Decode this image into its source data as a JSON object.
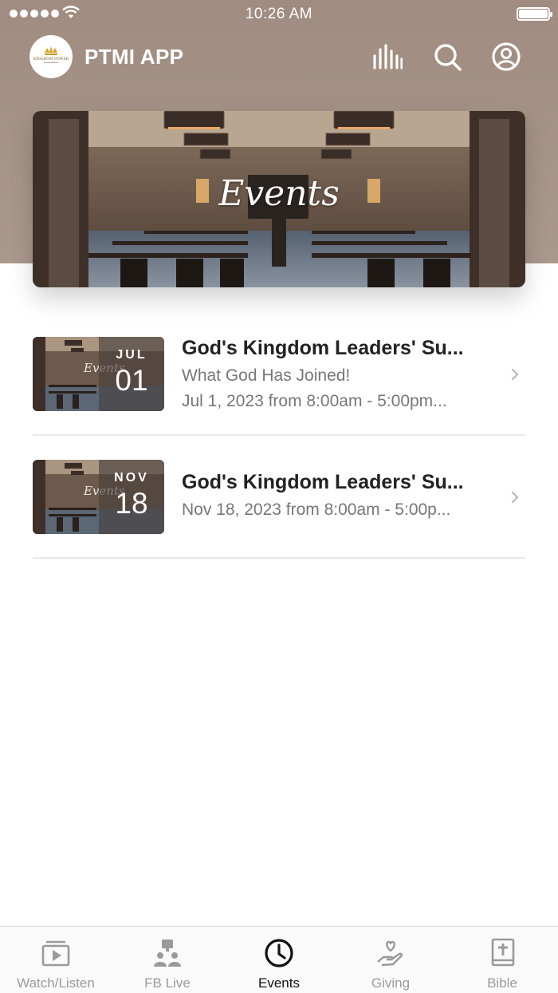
{
  "status_bar": {
    "time": "10:26 AM"
  },
  "header": {
    "app_title": "PTMI APP",
    "logo_text": "KINGDOM POWER",
    "icons": [
      "bars-chart-icon",
      "search-icon",
      "profile-icon"
    ]
  },
  "banner": {
    "title": "Events"
  },
  "events": [
    {
      "month": "JUL",
      "day": "01",
      "title": "God's Kingdom Leaders' Su...",
      "subtitle": "What God Has Joined!",
      "date_text": "Jul 1, 2023 from 8:00am - 5:00pm..."
    },
    {
      "month": "NOV",
      "day": "18",
      "title": "God's Kingdom Leaders' Su...",
      "date_text": "Nov 18, 2023 from 8:00am - 5:00p..."
    }
  ],
  "thumb_caption": "Events",
  "tabs": [
    {
      "label": "Watch/Listen",
      "icon": "play-video-icon",
      "active": false
    },
    {
      "label": "FB Live",
      "icon": "live-people-icon",
      "active": false
    },
    {
      "label": "Events",
      "icon": "clock-icon",
      "active": true
    },
    {
      "label": "Giving",
      "icon": "heart-hand-icon",
      "active": false
    },
    {
      "label": "Bible",
      "icon": "bible-icon",
      "active": false
    }
  ],
  "colors": {
    "header_bg": "#a08c80",
    "active_tab": "#111111",
    "inactive_tab": "#9a9a9a"
  }
}
